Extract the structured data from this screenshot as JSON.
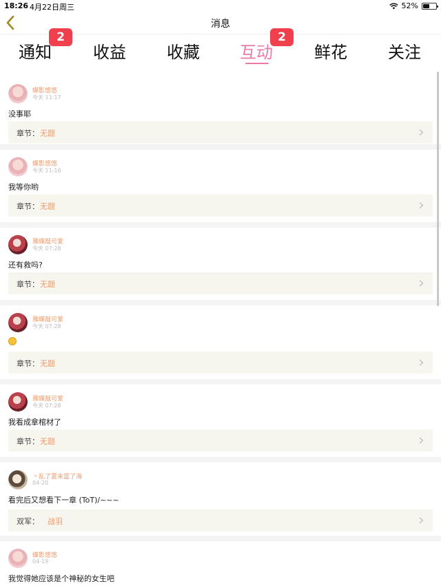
{
  "status_bar": {
    "time": "18:26",
    "date": "4月22日周三",
    "battery": "52%",
    "battery_level": 0.52
  },
  "nav": {
    "title": "消息"
  },
  "tabs": [
    {
      "label": "通知",
      "badge": "2"
    },
    {
      "label": "收益",
      "badge": ""
    },
    {
      "label": "收藏",
      "badge": ""
    },
    {
      "label": "互动",
      "badge": "2",
      "active": true
    },
    {
      "label": "鲜花",
      "badge": ""
    },
    {
      "label": "关注",
      "badge": ""
    }
  ],
  "items": [
    {
      "user": "蝶影悠悠",
      "time": "今天 11:17",
      "content": "没事耶",
      "chapter_label": "章节：",
      "chapter_value": "无题"
    },
    {
      "user": "蝶影悠悠",
      "time": "今天 11:16",
      "content": "我等你哟",
      "chapter_label": "章节：",
      "chapter_value": "无题"
    },
    {
      "user": "雅蝶敲可爱",
      "time": "今天 07:28",
      "content": "还有救吗?",
      "chapter_label": "章节：",
      "chapter_value": "无题"
    },
    {
      "user": "雅蝶敲可爱",
      "time": "今天 07:28",
      "content": "",
      "emoji": "laughing-emoji",
      "chapter_label": "章节：",
      "chapter_value": "无题"
    },
    {
      "user": "雅蝶敲可爱",
      "time": "今天 07:28",
      "content": "我看成拿棺材了",
      "chapter_label": "章节：",
      "chapter_value": "无题"
    },
    {
      "user": "丶乱了夏末蓝了海",
      "time": "04-20",
      "content": "看完后又想看下一章 (ToT)/~~~",
      "chapter_label": "双军：",
      "chapter_value": "战羽"
    },
    {
      "user": "蝶影悠悠",
      "time": "04-19",
      "content": "我觉得她应该是个神秘的女生吧"
    }
  ],
  "colors": {
    "accent": "#ec7aa6",
    "badge": "#f1404d",
    "username": "#ef9a6a",
    "chapter_bg": "#f6f5ee"
  }
}
